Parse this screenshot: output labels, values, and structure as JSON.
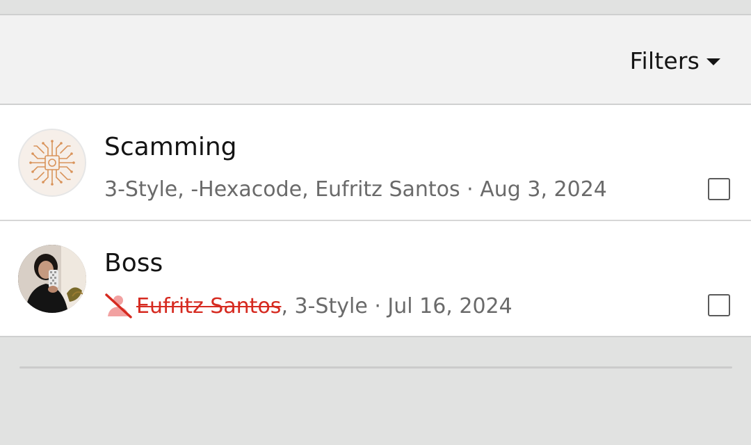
{
  "filters": {
    "label": "Filters"
  },
  "conversations": [
    {
      "title": "Scamming",
      "participants": "3-Style, -Hexacode, Eufritz Santos",
      "separator": " · ",
      "date": "Aug 3, 2024",
      "avatar": "circuit-chip-icon",
      "checked": false
    },
    {
      "title": "Boss",
      "removed_participant": "Eufritz Santos",
      "participants_rest": ", 3-Style",
      "separator": " · ",
      "date": "Jul 16, 2024",
      "avatar": "user-photo",
      "removed_icon": "person-off-icon",
      "checked": false
    }
  ],
  "colors": {
    "removed": "#d62a20",
    "removed_icon": "#f2a1a1",
    "meta_text": "#6a6a6a",
    "avatar_chip_accent": "#d9935a"
  }
}
